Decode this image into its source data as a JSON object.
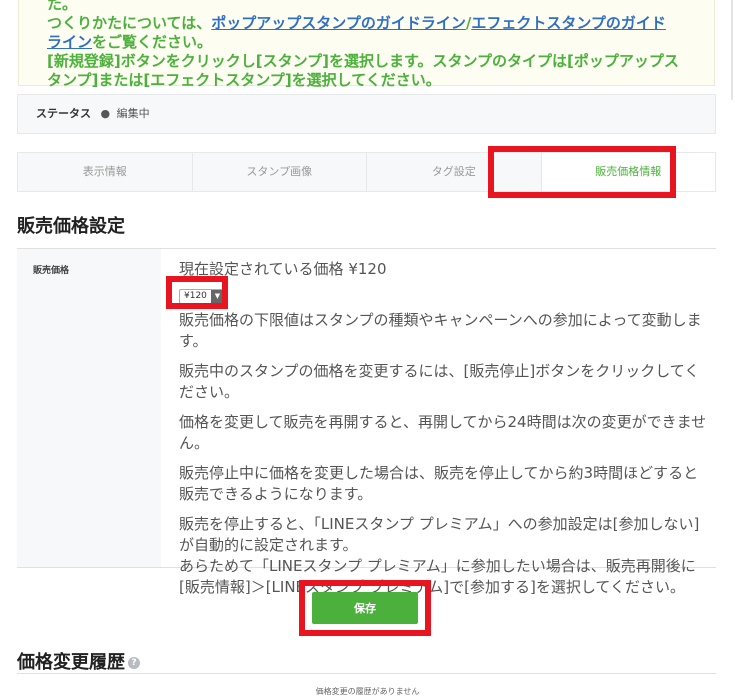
{
  "notice": {
    "line0": "た。",
    "guide_prefix": "つくりかたについては、",
    "guide_link_popup": "ポップアップスタンプのガイドライン",
    "guide_slash": "/",
    "guide_link_effect_1": "エフェクトスタンプのガイド",
    "guide_link_effect_2": "ライン",
    "guide_suffix": "をご覧ください。",
    "line3": "[新規登録]ボタンをクリックし[スタンプ]を選択します。スタンプのタイプは[ポップアップス",
    "line4": "タンプ]または[エフェクトスタンプ]を選択してください。"
  },
  "status": {
    "label": "ステータス",
    "value": "編集中"
  },
  "tabs": [
    {
      "label": "表示情報"
    },
    {
      "label": "スタンプ画像"
    },
    {
      "label": "タグ設定"
    },
    {
      "label": "販売価格情報"
    }
  ],
  "section_title": "販売価格設定",
  "price": {
    "label": "販売価格",
    "current": "現在設定されている価格 ¥120",
    "selected": "¥120",
    "notes": [
      "販売価格の下限値はスタンプの種類やキャンペーンへの参加によって変動します。",
      "販売中のスタンプの価格を変更するには、[販売停止]ボタンをクリックしてください。",
      "価格を変更して販売を再開すると、再開してから24時間は次の変更ができません。",
      "販売停止中に価格を変更した場合は、販売を停止してから約3時間ほどすると販売できるようになります。",
      "販売を停止すると、「LINEスタンプ プレミアム」への参加設定は[参加しない]が自動的に設定されます。",
      "あらためて「LINEスタンプ プレミアム」に参加したい場合は、販売再開後に[販売情報]＞[LINEスタンプ プレミアム]で[参加する]を選択してください。"
    ]
  },
  "save_label": "保存",
  "history": {
    "title": "価格変更履歴",
    "empty": "価格変更の履歴がありません"
  },
  "colors": {
    "accent_green": "#4cb13c",
    "highlight_red": "#e8141f",
    "link_blue": "#2f6fc4"
  },
  "icons": {
    "help": "question-mark-circle-icon",
    "status_dot": "bullet-dot-icon",
    "select_arrow": "triangle-down-icon"
  }
}
